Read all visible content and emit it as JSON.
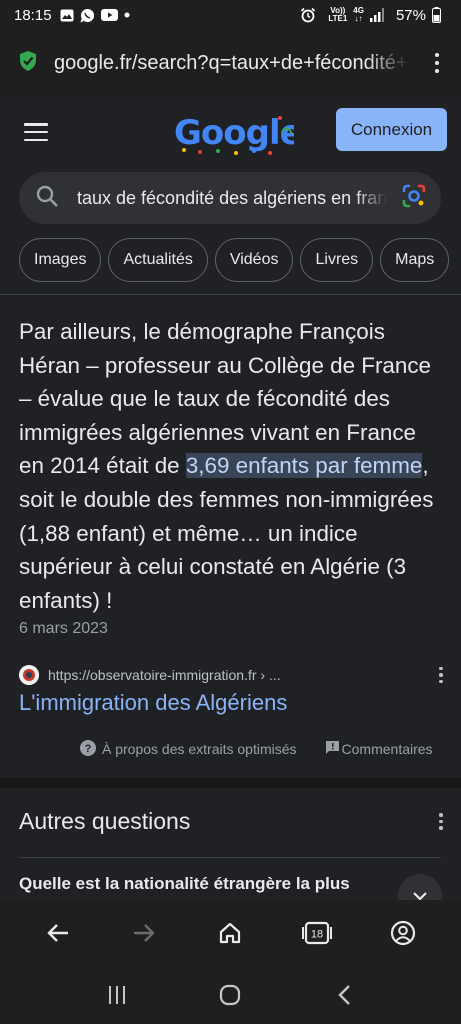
{
  "status_bar": {
    "time": "18:15",
    "network_top": "Vo))",
    "network_bottom": "LTE1",
    "network_gen": "4G",
    "battery": "57%"
  },
  "address_bar": {
    "url": "google.fr/search?q=taux+de+fécondité+des+algériens+en+france"
  },
  "header": {
    "logo_text": "Google",
    "login_label": "Connexion"
  },
  "search": {
    "query": "taux de fécondité des algériens en france"
  },
  "chips": [
    "Images",
    "Actualités",
    "Vidéos",
    "Livres",
    "Maps"
  ],
  "snippet": {
    "text_before": "Par ailleurs, le démographe François Héran – professeur au Collège de France – évalue que le taux de fécondité des immigrées algériennes vivant en France en 2014 était de ",
    "highlight": "3,69 enfants par femme",
    "text_after": ", soit le double des femmes non-immigrées (1,88 enfant) et même… un indice supérieur à celui constaté en Algérie (3 enfants) !",
    "date": "6 mars 2023"
  },
  "result": {
    "source_url": "https://observatoire-immigration.fr › ...",
    "title": "L'immigration des Algériens"
  },
  "feedback": {
    "about_label": "À propos des extraits optimisés",
    "comments_label": "Commentaires"
  },
  "people_also_ask": {
    "title": "Autres questions",
    "question": "Quelle est la nationalité étrangère la plus"
  },
  "browser_nav": {
    "tab_count": "18"
  },
  "colors": {
    "background": "#202124",
    "link": "#8ab4f8",
    "button": "#8ab4f8",
    "highlight_bg": "#394457",
    "shield": "#34a853"
  },
  "icons": {
    "status_left": [
      "gallery-icon",
      "whatsapp-icon",
      "youtube-icon",
      "dot-icon"
    ],
    "status_right": [
      "alarm-icon",
      "signal-icon",
      "battery-icon"
    ],
    "address": [
      "shield-check-icon",
      "more-vert-icon"
    ],
    "browser_nav": [
      "back-arrow-icon",
      "forward-arrow-icon",
      "home-icon",
      "tabs-icon",
      "account-icon"
    ],
    "system_nav": [
      "recents-icon",
      "home-circle-icon",
      "back-chevron-icon"
    ]
  }
}
